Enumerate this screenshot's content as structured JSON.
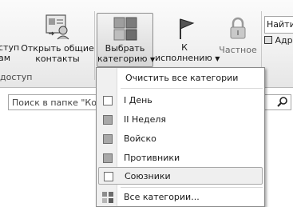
{
  "ribbon": {
    "left_partial_top": "ступ",
    "left_partial_bottom": "ам",
    "open_shared_contacts": {
      "line1": "Открыть общие",
      "line2": "контакты"
    },
    "group_share_label": "доступ",
    "choose_category": {
      "line1": "Выбрать",
      "line2": "категорию"
    },
    "to_execution": {
      "line1": "К",
      "line2": "исполнению"
    },
    "private": {
      "label": "Частное"
    },
    "find_box": "Найти",
    "address_book": "Адр"
  },
  "search": {
    "placeholder": "Поиск в папке \"Конт"
  },
  "category_menu": {
    "clear_all": "Очистить все категории",
    "items": [
      {
        "label": "I День",
        "color": "#ffffff"
      },
      {
        "label": "II Неделя",
        "color": "#a8a8a8"
      },
      {
        "label": "Войско",
        "color": "#a8a8a8"
      },
      {
        "label": "Противники",
        "color": "#a8a8a8"
      },
      {
        "label": "Союзники",
        "color": "#ffffff"
      }
    ],
    "all_categories": "Все категории..."
  }
}
